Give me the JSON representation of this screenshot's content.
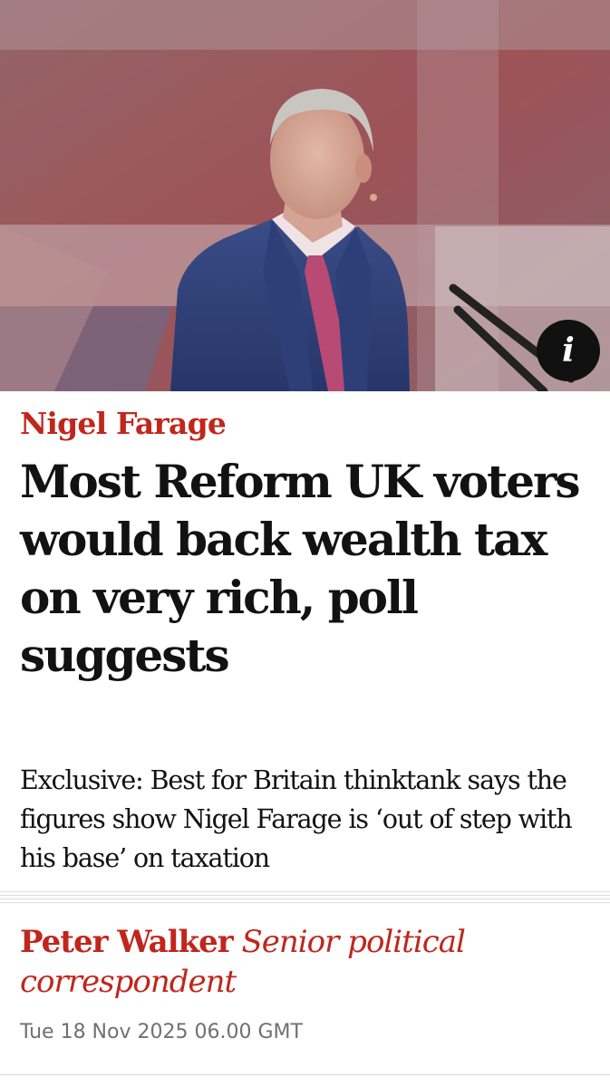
{
  "hero": {
    "info_icon": "info-icon",
    "info_label": "i"
  },
  "article": {
    "kicker": "Nigel Farage",
    "headline": "Most Reform UK voters would back wealth tax on very rich, poll suggests",
    "standfirst": "Exclusive: Best for Britain thinktank says the figures show Nigel Farage is ‘out of step with his base’ on taxation",
    "byline": {
      "author": "Peter Walker",
      "role": "Senior political correspondent"
    },
    "date": "Tue 18 Nov 2025 06.00 GMT"
  },
  "colors": {
    "accent": "#c0261c",
    "text": "#121212",
    "meta": "#707070"
  }
}
